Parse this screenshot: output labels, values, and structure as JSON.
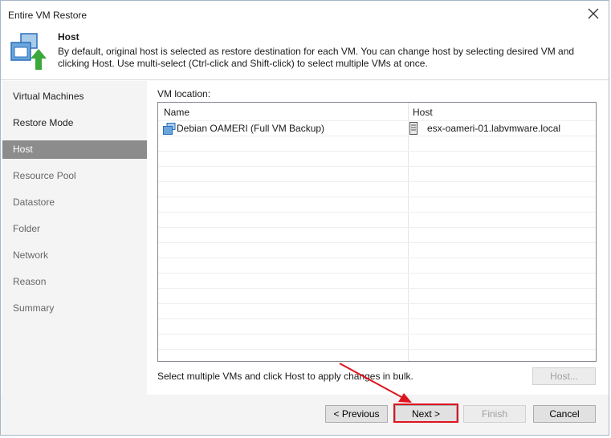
{
  "window": {
    "title": "Entire VM Restore"
  },
  "header": {
    "title": "Host",
    "description": "By default, original host is selected as restore destination for each VM. You can change host by selecting desired VM and clicking Host. Use multi-select (Ctrl-click and Shift-click) to select multiple VMs at once."
  },
  "sidebar": {
    "items": [
      {
        "label": "Virtual Machines",
        "state": "done"
      },
      {
        "label": "Restore Mode",
        "state": "done"
      },
      {
        "label": "Host",
        "state": "active"
      },
      {
        "label": "Resource Pool",
        "state": "pending"
      },
      {
        "label": "Datastore",
        "state": "pending"
      },
      {
        "label": "Folder",
        "state": "pending"
      },
      {
        "label": "Network",
        "state": "pending"
      },
      {
        "label": "Reason",
        "state": "pending"
      },
      {
        "label": "Summary",
        "state": "pending"
      }
    ]
  },
  "main": {
    "vm_location_label": "VM location:",
    "columns": [
      "Name",
      "Host"
    ],
    "rows": [
      {
        "name": "Debian OAMERI (Full VM Backup)",
        "host": "esx-oameri-01.labvmware.local",
        "name_icon": "vm-icon",
        "host_icon": "server-icon"
      }
    ],
    "hint": "Select multiple VMs and click Host to apply changes in bulk.",
    "host_button": "Host..."
  },
  "footer": {
    "previous": "< Previous",
    "next": "Next >",
    "finish": "Finish",
    "cancel": "Cancel"
  },
  "colors": {
    "highlight": "#e0141e",
    "active_step": "#8c8c8c",
    "accent_green": "#3ba83b"
  }
}
